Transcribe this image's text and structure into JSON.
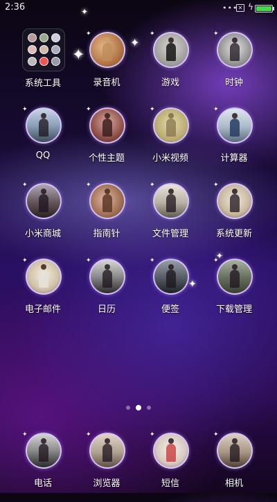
{
  "status": {
    "time": "2:36",
    "battery_percent": 100,
    "battery_color": "#48d84a"
  },
  "home": {
    "folder": {
      "label": "系统工具",
      "icon": "folder-icon"
    },
    "apps": [
      {
        "label": "录音机"
      },
      {
        "label": "游戏"
      },
      {
        "label": "时钟"
      },
      {
        "label": "QQ"
      },
      {
        "label": "个性主题"
      },
      {
        "label": "小米视频"
      },
      {
        "label": "计算器"
      },
      {
        "label": "小米商城"
      },
      {
        "label": "指南针"
      },
      {
        "label": "文件管理"
      },
      {
        "label": "系统更新"
      },
      {
        "label": "电子邮件"
      },
      {
        "label": "日历"
      },
      {
        "label": "便签"
      },
      {
        "label": "下载管理"
      }
    ],
    "pager": {
      "pages": 3,
      "current": 2
    }
  },
  "dock": {
    "apps": [
      {
        "label": "电话"
      },
      {
        "label": "浏览器"
      },
      {
        "label": "短信"
      },
      {
        "label": "相机"
      }
    ]
  }
}
